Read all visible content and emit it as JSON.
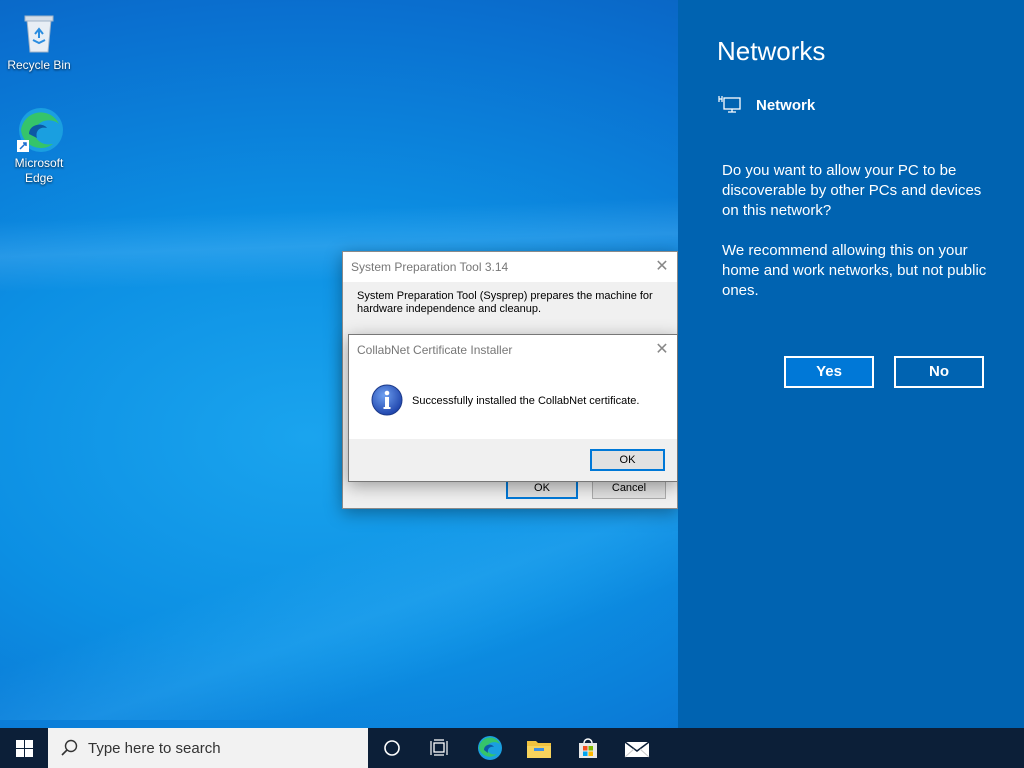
{
  "desktop": {
    "icons": [
      {
        "label": "Recycle Bin",
        "icon": "recycle-bin-icon"
      },
      {
        "label": "Microsoft Edge",
        "icon": "edge-icon"
      }
    ]
  },
  "sysprep_dialog": {
    "title": "System Preparation Tool 3.14",
    "description": "System Preparation Tool (Sysprep) prepares the machine for hardware independence and cleanup.",
    "ok_label": "OK",
    "cancel_label": "Cancel"
  },
  "certificate_dialog": {
    "title": "CollabNet Certificate Installer",
    "message": "Successfully installed the CollabNet certificate.",
    "ok_label": "OK",
    "icon": "info-icon"
  },
  "network_panel": {
    "heading": "Networks",
    "network_name": "Network",
    "question": "Do you want to allow your PC to be discoverable by other PCs and devices on this network?",
    "recommendation": "We recommend allowing this on your home and work networks, but not public ones.",
    "yes_label": "Yes",
    "no_label": "No",
    "bg_color": "#0063b1",
    "accent_color": "#0078d7"
  },
  "taskbar": {
    "search_placeholder": "Type here to search",
    "icons": [
      "windows-start-icon",
      "search-icon",
      "cortana-icon",
      "task-view-icon",
      "edge-icon",
      "file-explorer-icon",
      "store-icon",
      "mail-icon"
    ]
  }
}
